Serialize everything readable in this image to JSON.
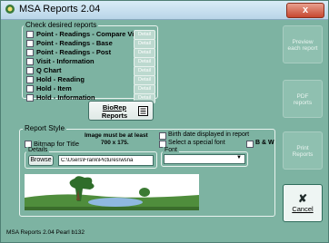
{
  "window": {
    "title": "MSA Reports 2.04",
    "close_label": "x"
  },
  "reports": {
    "group_label": "Check desired reports",
    "items": [
      {
        "label": "Point - Readings - Compare Visits",
        "detail": "Detail"
      },
      {
        "label": "Point - Readings - Base",
        "detail": "Detail"
      },
      {
        "label": "Point - Readings - Post",
        "detail": "Detail"
      },
      {
        "label": "Visit - Information",
        "detail": "Detail"
      },
      {
        "label": "Q Chart",
        "detail": "Detail"
      },
      {
        "label": "Hold - Reading",
        "detail": "Detail"
      },
      {
        "label": "Hold - Item",
        "detail": "Detail"
      },
      {
        "label": "Hold - Information",
        "detail": "Detail"
      }
    ],
    "biorep_label_1": "BioRep",
    "biorep_label_2": "Reports"
  },
  "style": {
    "group_label": "Report Style",
    "bitmap_label": "Bitmap for Title",
    "bitmap_note_1": "Image must be at least",
    "bitmap_note_2": "700 x 175.",
    "details_label": "Details",
    "browse_label": "Browse",
    "path_value": "C:\\Users\\Frank\\Pictures\\wsna",
    "birth_date_label": "Birth date displayed in report",
    "special_font_label": "Select a special font",
    "bw_label": "B & W",
    "font_label": "Font",
    "font_value": ""
  },
  "side_buttons": {
    "preview_1": "Preview",
    "preview_2": "each report",
    "pdf_1": "PDF",
    "pdf_2": "reports",
    "print_1": "Print",
    "print_2": "Reports",
    "cancel_icon": "✘",
    "cancel_label": "Cancel"
  },
  "status": {
    "text": "MSA Reports 2.04 Pearl b132"
  },
  "colors": {
    "background": "#7db3a2",
    "accent": "#3f6e64"
  }
}
